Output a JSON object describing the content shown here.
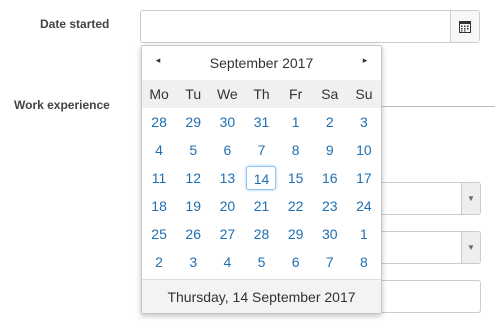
{
  "form": {
    "date_started_label": "Date started",
    "work_experience_label": "Work experience"
  },
  "calendar": {
    "prev_glyph": "◂",
    "next_glyph": "▸",
    "month_title": "September 2017",
    "weekdays": [
      "Mo",
      "Tu",
      "We",
      "Th",
      "Fr",
      "Sa",
      "Su"
    ],
    "weeks": [
      [
        "28",
        "29",
        "30",
        "31",
        "1",
        "2",
        "3"
      ],
      [
        "4",
        "5",
        "6",
        "7",
        "8",
        "9",
        "10"
      ],
      [
        "11",
        "12",
        "13",
        "14",
        "15",
        "16",
        "17"
      ],
      [
        "18",
        "19",
        "20",
        "21",
        "22",
        "23",
        "24"
      ],
      [
        "25",
        "26",
        "27",
        "28",
        "29",
        "30",
        "1"
      ],
      [
        "2",
        "3",
        "4",
        "5",
        "6",
        "7",
        "8"
      ]
    ],
    "selected_day": "14",
    "footer": "Thursday, 14 September 2017"
  },
  "colors": {
    "day_link": "#1f6fb2",
    "highlight_border": "#8ec3f0"
  },
  "icons": {
    "calendar_button": "calendar-icon",
    "select_arrow": "caret-down-icon"
  }
}
